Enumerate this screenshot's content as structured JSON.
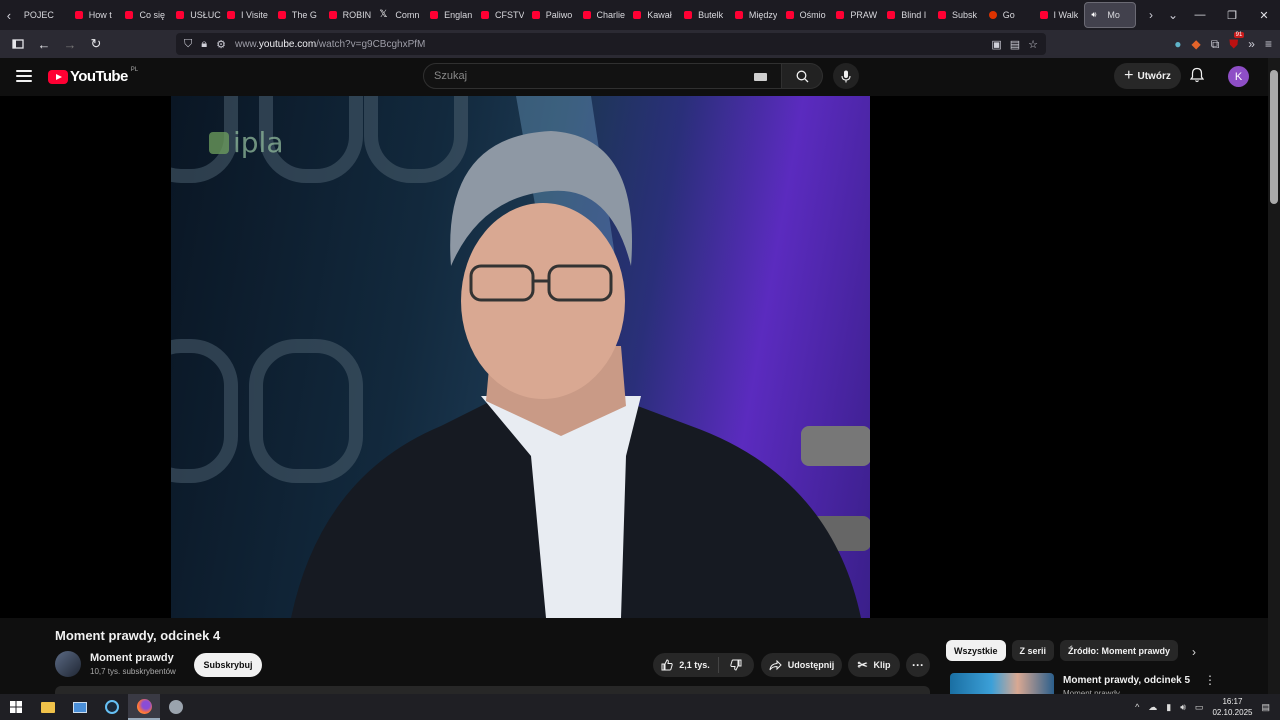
{
  "browser": {
    "tabs": [
      {
        "label": "POJEC",
        "icon": "none"
      },
      {
        "label": "How t",
        "icon": "youtube-icon"
      },
      {
        "label": "Co się",
        "icon": "youtube-icon"
      },
      {
        "label": "USŁUC",
        "icon": "youtube-icon"
      },
      {
        "label": "I Visite",
        "icon": "youtube-icon"
      },
      {
        "label": "The G",
        "icon": "youtube-icon"
      },
      {
        "label": "ROBIN",
        "icon": "youtube-icon"
      },
      {
        "label": "Comn",
        "icon": "x-icon"
      },
      {
        "label": "Englan",
        "icon": "youtube-icon"
      },
      {
        "label": "CFSTV",
        "icon": "youtube-icon"
      },
      {
        "label": "Paliwo",
        "icon": "youtube-icon"
      },
      {
        "label": "Charlie",
        "icon": "youtube-icon"
      },
      {
        "label": "Kawał",
        "icon": "youtube-icon"
      },
      {
        "label": "Butelk",
        "icon": "youtube-icon"
      },
      {
        "label": "Między",
        "icon": "youtube-icon"
      },
      {
        "label": "Ośmio",
        "icon": "youtube-icon"
      },
      {
        "label": "PRAW",
        "icon": "youtube-icon"
      },
      {
        "label": "Blind I",
        "icon": "youtube-icon"
      },
      {
        "label": "Subsk",
        "icon": "youtube-icon"
      },
      {
        "label": "Go",
        "icon": "record-icon"
      },
      {
        "label": "I Walk",
        "icon": "youtube-icon"
      },
      {
        "label": "Mo",
        "icon": "speaker-icon",
        "active": true
      }
    ],
    "url_prefix": "www.",
    "url_host": "youtube.com",
    "url_path": "/watch?v=g9CBcghxPfM",
    "extension_badge": "91"
  },
  "youtube": {
    "logo_text": "YouTube",
    "country_code": "PL",
    "search_placeholder": "Szukaj",
    "create_label": "Utwórz",
    "avatar_letter": "K"
  },
  "video": {
    "watermark": "ipla",
    "title": "Moment prawdy, odcinek 4",
    "channel_name": "Moment prawdy",
    "subscribers": "10,7 tys. subskrybentów",
    "subscribe_label": "Subskrybuj",
    "likes": "2,1 tys.",
    "share_label": "Udostępnij",
    "clip_label": "Klip"
  },
  "sidebar": {
    "chips": [
      "Wszystkie",
      "Z serii",
      "Źródło: Moment prawdy"
    ],
    "recommendation": {
      "title": "Moment prawdy, odcinek 5",
      "channel": "Moment prawdy"
    }
  },
  "taskbar": {
    "time": "16:17",
    "date": "02.10.2025"
  }
}
